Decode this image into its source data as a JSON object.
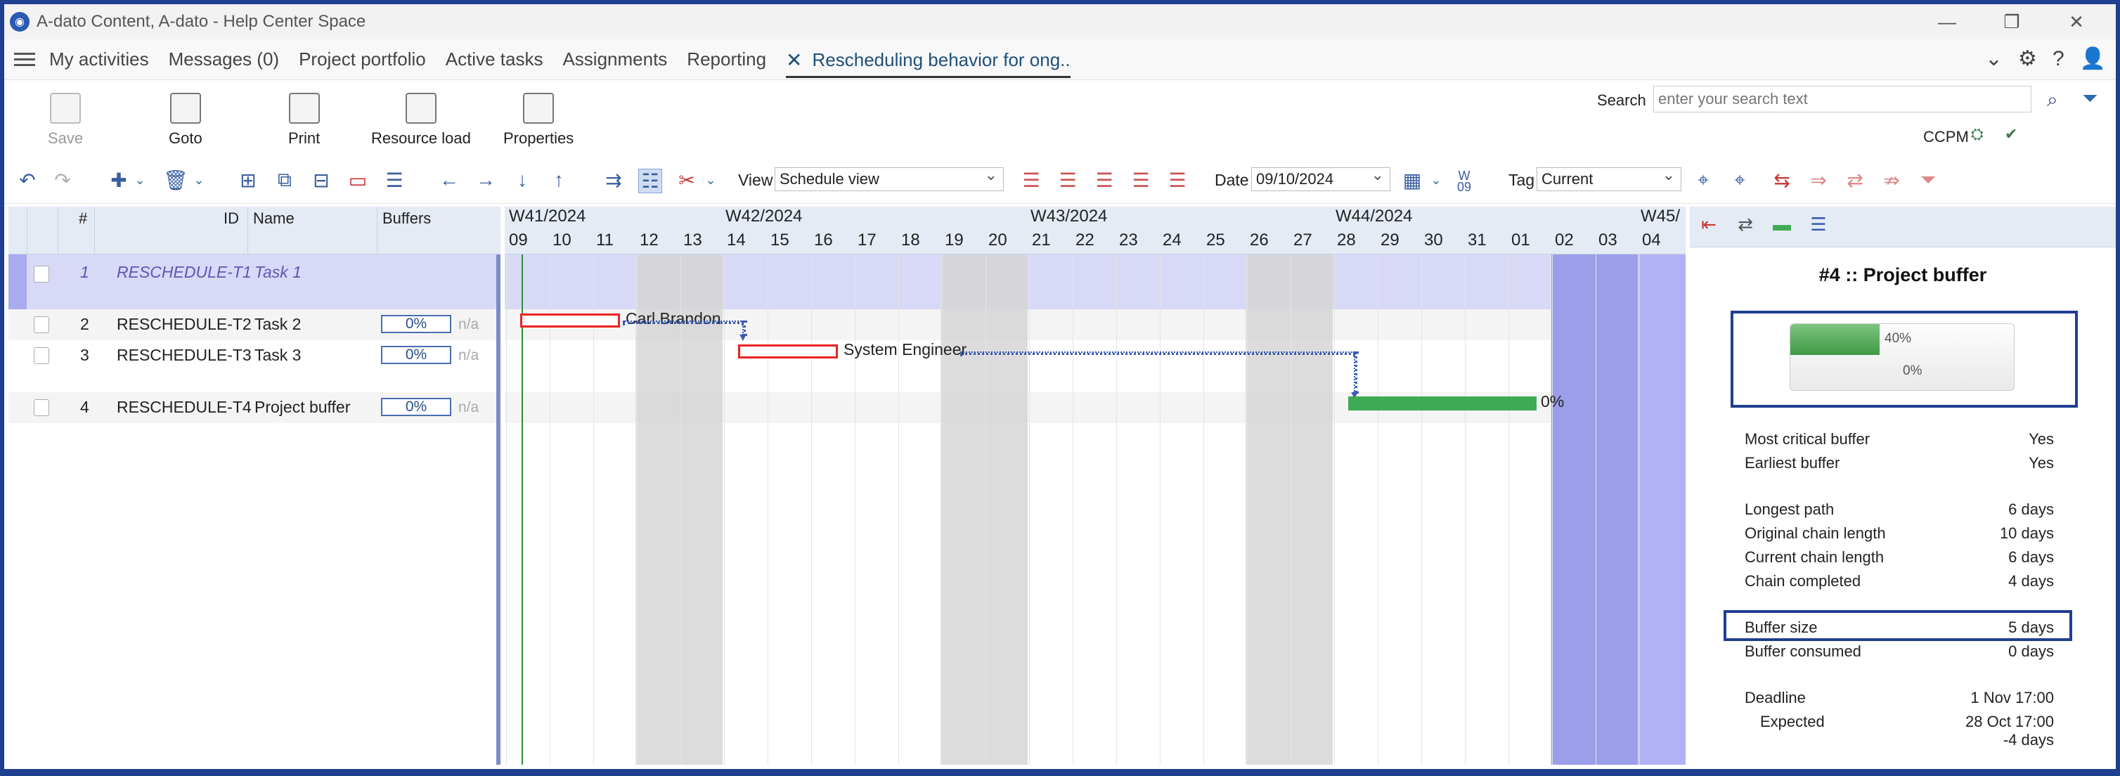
{
  "window": {
    "title": "A-dato Content, A-dato - Help Center Space",
    "controls": {
      "minimize": "—",
      "restore": "❐",
      "close": "✕"
    }
  },
  "menu": {
    "items": [
      "My activities",
      "Messages (0)",
      "Project portfolio",
      "Active tasks",
      "Assignments",
      "Reporting"
    ],
    "active_tab": "Rescheduling behavior for ong.."
  },
  "ribbon": {
    "buttons": [
      {
        "label": "Save",
        "icon": "save-icon",
        "enabled": false
      },
      {
        "label": "Goto",
        "icon": "goto-icon",
        "enabled": true
      },
      {
        "label": "Print",
        "icon": "printer-icon",
        "enabled": true
      },
      {
        "label": "Resource load",
        "icon": "resource-load-icon",
        "enabled": true
      },
      {
        "label": "Properties",
        "icon": "properties-icon",
        "enabled": true
      }
    ],
    "search_label": "Search",
    "search_placeholder": "enter your search text",
    "ccpm_label": "CCPM"
  },
  "toolbar": {
    "view_label": "View",
    "view_value": "Schedule view",
    "date_label": "Date",
    "date_value": "09/10/2024",
    "tag_label": "Tag",
    "tag_value": "Current",
    "date_icon_text": "W 09"
  },
  "grid": {
    "headers": {
      "num": "#",
      "id": "ID",
      "name": "Name",
      "buffers": "Buffers"
    },
    "rows": [
      {
        "num": "1",
        "id": "RESCHEDULE-T1",
        "name": "Task 1",
        "buffer": "",
        "na": "",
        "summary": true
      },
      {
        "num": "2",
        "id": "RESCHEDULE-T2",
        "name": "Task 2",
        "buffer": "0%",
        "na": "n/a"
      },
      {
        "num": "3",
        "id": "RESCHEDULE-T3",
        "name": "Task 3",
        "buffer": "0%",
        "na": "n/a"
      },
      {
        "num": "4",
        "id": "RESCHEDULE-T4",
        "name": "Project buffer",
        "buffer": "0%",
        "na": "n/a"
      }
    ]
  },
  "gantt": {
    "weeks": [
      "W41/2024",
      "W42/2024",
      "W43/2024",
      "W44/2024",
      "W45/"
    ],
    "days": [
      "09",
      "10",
      "11",
      "12",
      "13",
      "14",
      "15",
      "16",
      "17",
      "18",
      "19",
      "20",
      "21",
      "22",
      "23",
      "24",
      "25",
      "26",
      "27",
      "28",
      "29",
      "30",
      "31",
      "01",
      "02",
      "03",
      "04"
    ],
    "task2_resource": "Carl Brandon",
    "task3_resource": "System Engineer",
    "buffer_percent": "0%"
  },
  "panel": {
    "title": "#4 :: Project buffer",
    "gauge": {
      "top_label": "40%",
      "bottom_label": "0%",
      "fill_fraction": 0.4
    },
    "rows": [
      {
        "label": "Most critical buffer",
        "value": "Yes"
      },
      {
        "label": "Earliest buffer",
        "value": "Yes"
      },
      {
        "label": "Longest path",
        "value": "6 days"
      },
      {
        "label": "Original chain length",
        "value": "10 days"
      },
      {
        "label": "Current chain length",
        "value": "6 days"
      },
      {
        "label": "Chain completed",
        "value": "4 days"
      },
      {
        "label": "Buffer size",
        "value": "5 days"
      },
      {
        "label": "Buffer consumed",
        "value": "0 days"
      },
      {
        "label": "Deadline",
        "value": "1 Nov 17:00"
      },
      {
        "label": "Expected",
        "value": "28 Oct 17:00"
      },
      {
        "label": "",
        "value": "-4 days"
      }
    ]
  }
}
